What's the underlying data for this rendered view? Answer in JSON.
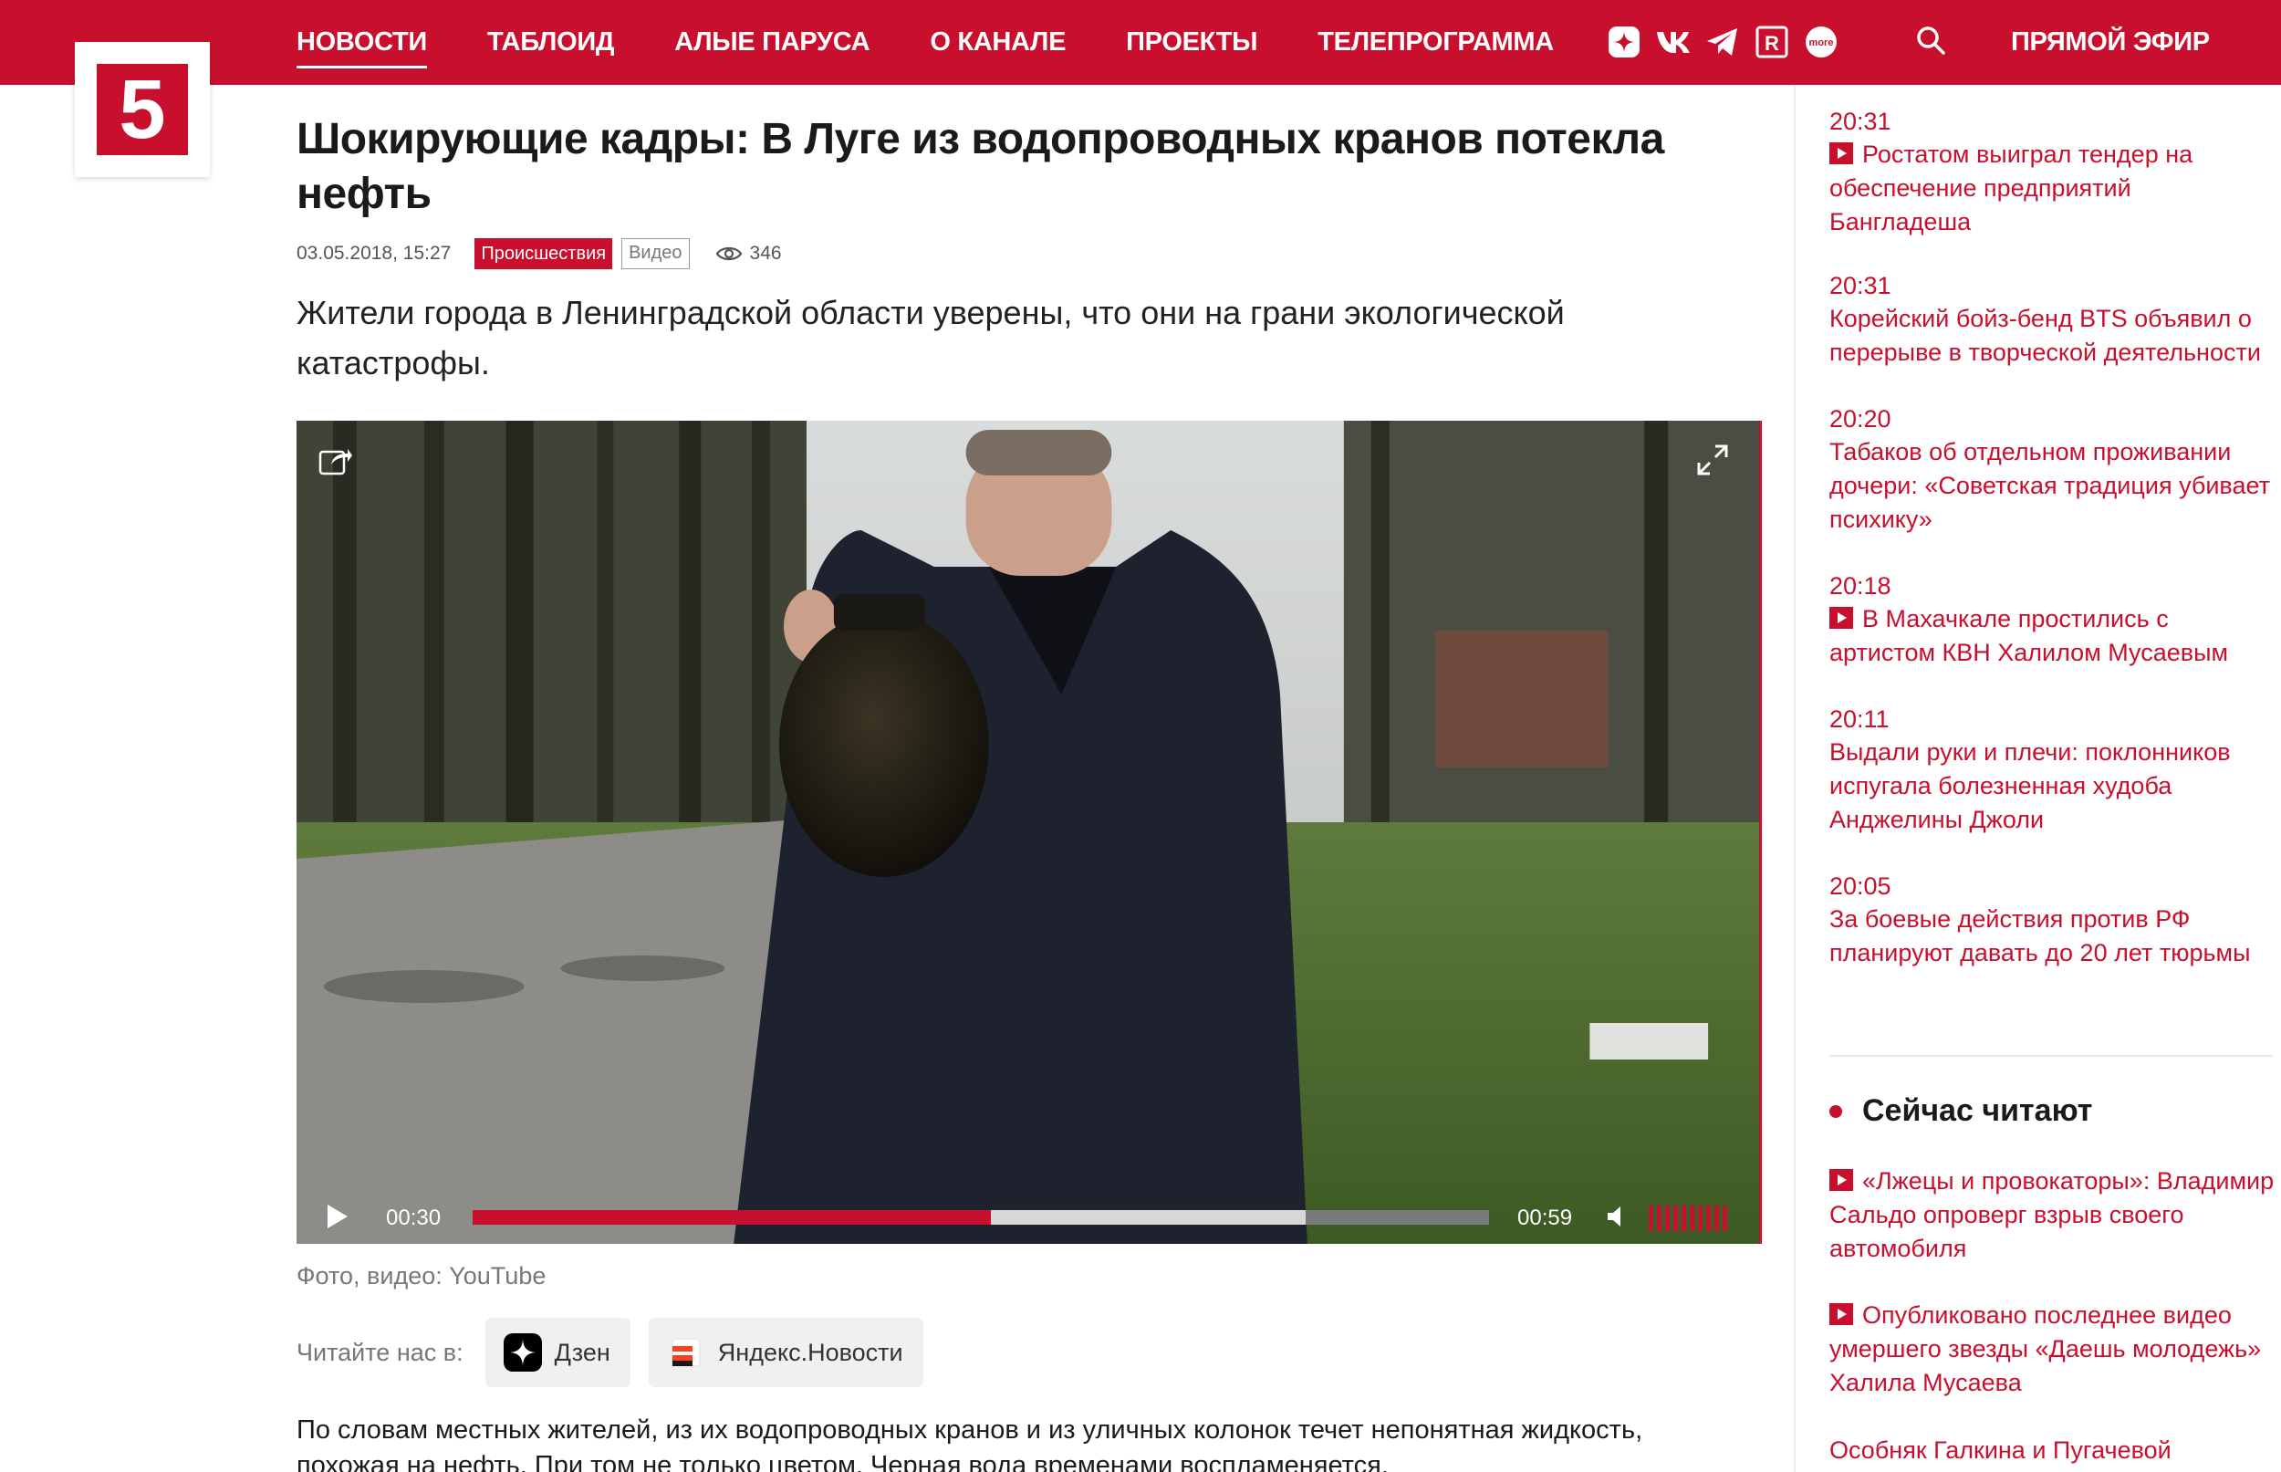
{
  "brand": {
    "logo_text": "5",
    "accent": "#c8102e"
  },
  "nav": {
    "items": [
      {
        "label": "НОВОСТИ",
        "active": true
      },
      {
        "label": "ТАБЛОИД",
        "active": false
      },
      {
        "label": "АЛЫЕ ПАРУСА",
        "active": false
      },
      {
        "label": "О КАНАЛЕ",
        "active": false
      },
      {
        "label": "ПРОЕКТЫ",
        "active": false
      },
      {
        "label": "ТЕЛЕПРОГРАММА",
        "active": false
      }
    ],
    "social_icons": [
      "dzen-icon",
      "vk-icon",
      "telegram-icon",
      "rutube-icon",
      "more-tv-icon"
    ],
    "more_label": "more",
    "rutube_label": "R",
    "live_label": "ПРЯМОЙ ЭФИР"
  },
  "article": {
    "title": "Шокирующие кадры: В Луге из водопроводных кранов потекла нефть",
    "date": "03.05.2018, 15:27",
    "tags": [
      "Происшествия",
      "Видео"
    ],
    "views": "346",
    "lead": "Жители города в Ленинградской области уверены, что они на грани экологической катастрофы.",
    "video": {
      "current_time": "00:30",
      "duration": "00:59",
      "progress": 0.51,
      "buffered": 0.82
    },
    "caption": "Фото, видео: YouTube",
    "read_us": {
      "label": "Читайте нас в:",
      "services": [
        "Дзен",
        "Яндекс.Новости"
      ]
    },
    "body": "По словам местных жителей, из их водопроводных кранов и из уличных колонок течет непонятная жидкость, похожая на нефть. При том не только цветом. Черная вода временами воспламеняется."
  },
  "sidebar": {
    "news": [
      {
        "time": "20:31",
        "title": "Ростатом выиграл тендер на обеспечение предприятий Бангладеша",
        "video": true
      },
      {
        "time": "20:31",
        "title": "Корейский бойз-бенд BTS объявил о перерыве в творческой деятельности",
        "video": false
      },
      {
        "time": "20:20",
        "title": "Табаков об отдельном проживании дочери: «Советская традиция убивает психику»",
        "video": false
      },
      {
        "time": "20:18",
        "title": "В Махачкале простились с артистом КВН Халилом Мусаевым",
        "video": true
      },
      {
        "time": "20:11",
        "title": "Выдали руки и плечи: поклонников испугала болезненная худоба Анджелины Джоли",
        "video": false
      },
      {
        "time": "20:05",
        "title": "За боевые действия против РФ планируют давать до 20 лет тюрьмы",
        "video": false
      }
    ],
    "now_reading": {
      "heading": "Сейчас читают",
      "items": [
        {
          "title": "«Лжецы и провокаторы»: Владимир Сальдо опроверг взрыв своего автомобиля",
          "video": true
        },
        {
          "title": "Опубликовано последнее видео умершего звезды «Даешь молодежь» Халила Мусаева",
          "video": true
        },
        {
          "title": "Особняк Галкина и Пугачевой",
          "video": false
        }
      ]
    }
  }
}
